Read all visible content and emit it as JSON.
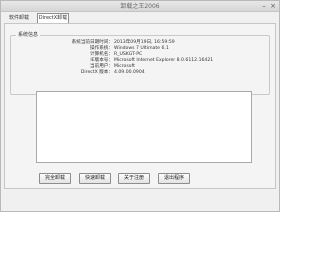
{
  "window": {
    "title": "卸载之王2006",
    "minimize_glyph": "–",
    "close_glyph": "×"
  },
  "tabs": [
    {
      "label": "软件卸载"
    },
    {
      "label": "DirectX卸载"
    }
  ],
  "system_info": {
    "legend": "系统信息",
    "rows": [
      {
        "key": "系统当前日期时间：",
        "value": "2013年09月19日, 16:59:59"
      },
      {
        "key": "操作系统：",
        "value": "Windows 7 Ultimate 6.1"
      },
      {
        "key": "计算机名：",
        "value": "R_USKGT-PC"
      },
      {
        "key": "IE版本号：",
        "value": "Microsoft Internet Explorer 8.0.6112.16421"
      },
      {
        "key": "当前用户：",
        "value": "Microsoft"
      },
      {
        "key": "DirectX 版本：",
        "value": "4.09.00.0904"
      }
    ]
  },
  "log": {
    "text": ""
  },
  "buttons": [
    {
      "label": "完全卸载"
    },
    {
      "label": "快速卸载"
    },
    {
      "label": "关于注册"
    },
    {
      "label": "退出程序"
    }
  ]
}
